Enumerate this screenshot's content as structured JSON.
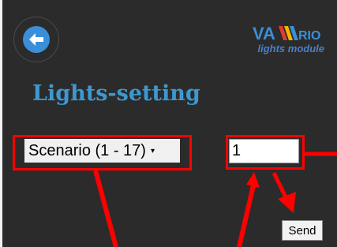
{
  "header": {
    "back_icon": "arrow-left-icon",
    "logo": {
      "brand": "VA|||RIO",
      "tagline": "lights module"
    }
  },
  "page": {
    "title": "Lights-setting"
  },
  "controls": {
    "scenario_select": {
      "selected": "Scenario (1 - 17)",
      "arrow": "▾"
    },
    "scenario_number": {
      "value": "1"
    },
    "send_label": "Send"
  },
  "colors": {
    "background": "#2b2b2b",
    "title": "#3d98d0",
    "accent_blue": "#3a8fd8",
    "annotation_red": "#ff0000"
  }
}
